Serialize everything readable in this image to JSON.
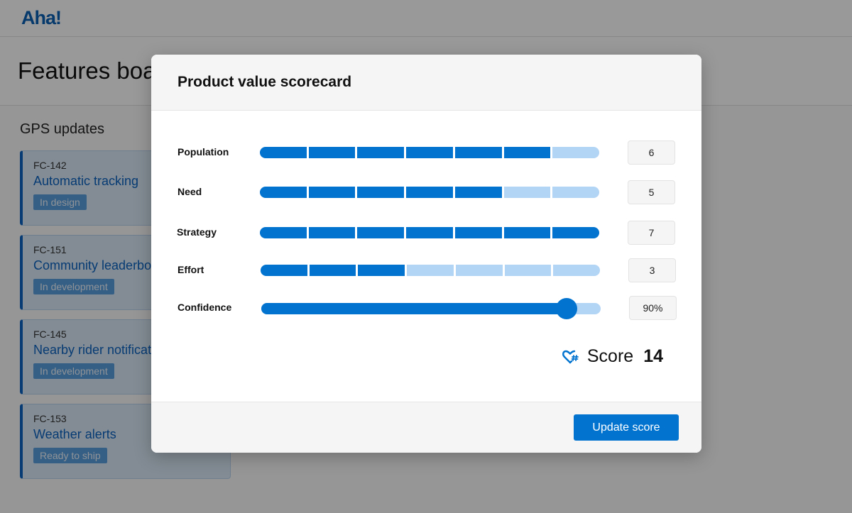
{
  "app": {
    "logo": "Aha!",
    "page_title": "Features board",
    "column_title": "GPS updates",
    "cards": [
      {
        "id": "FC-142",
        "title": "Automatic tracking",
        "status": "In design"
      },
      {
        "id": "FC-151",
        "title": "Community leaderboard",
        "status": "In development"
      },
      {
        "id": "FC-145",
        "title": "Nearby rider notifications",
        "status": "In development"
      },
      {
        "id": "FC-153",
        "title": "Weather alerts",
        "status": "Ready to ship"
      }
    ]
  },
  "modal": {
    "title": "Product value scorecard",
    "metrics": [
      {
        "label": "Population",
        "value": 6,
        "max": 7,
        "display": "6"
      },
      {
        "label": "Need",
        "value": 5,
        "max": 7,
        "display": "5"
      },
      {
        "label": "Strategy",
        "value": 7,
        "max": 7,
        "display": "7"
      },
      {
        "label": "Effort",
        "value": 3,
        "max": 7,
        "display": "3"
      }
    ],
    "confidence": {
      "label": "Confidence",
      "percent": 90,
      "display": "90%"
    },
    "score": {
      "icon": "heart-hash-icon",
      "label": "Score",
      "value": "14"
    },
    "update_button": "Update score"
  },
  "colors": {
    "accent": "#0274d0",
    "accent_light": "#b2d4f5",
    "logo": "#0a5fb4"
  }
}
